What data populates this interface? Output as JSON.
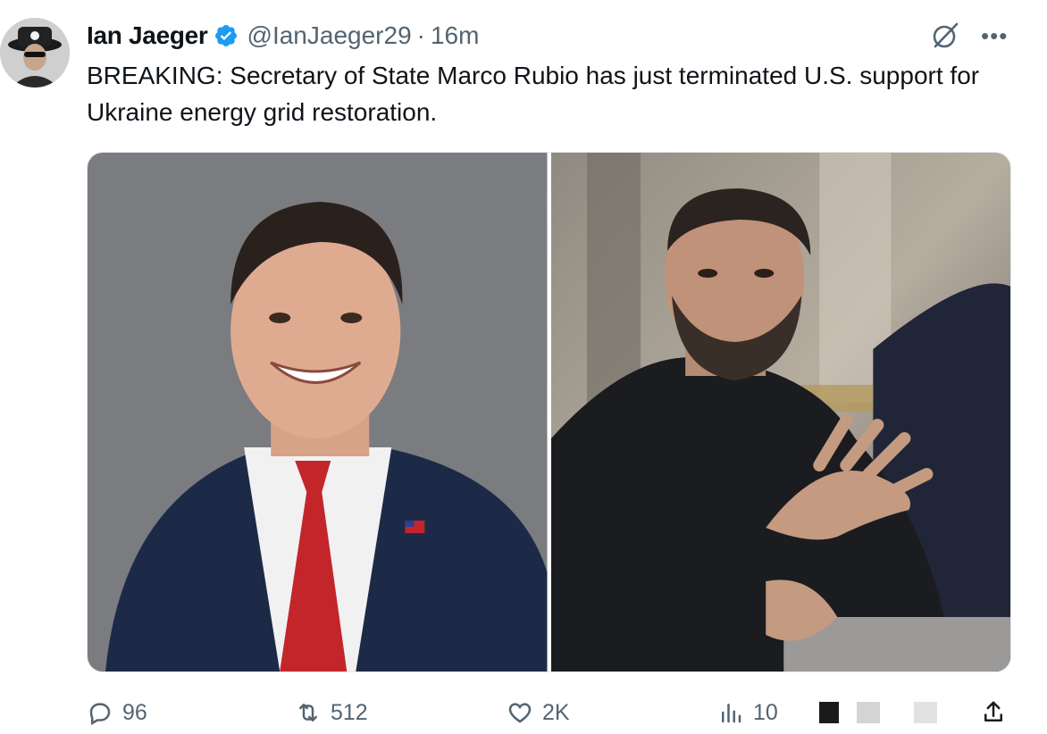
{
  "author": {
    "name": "Ian Jaeger",
    "handle": "@IanJaeger29",
    "separator": "·",
    "time": "16m",
    "verified": true,
    "verified_color": "#1d9bf0",
    "avatar_icon": "avatar-image"
  },
  "top_actions": {
    "grok_icon": "grok-icon",
    "more_label": "•••"
  },
  "tweet": {
    "text": "BREAKING: Secretary of State Marco Rubio has just terminated U.S. support for Ukraine energy grid restoration."
  },
  "media": {
    "photo_count": 2
  },
  "actions": {
    "reply_count": "96",
    "retweet_count": "512",
    "like_count": "2K",
    "views_count": "10",
    "accent": "#536471"
  }
}
